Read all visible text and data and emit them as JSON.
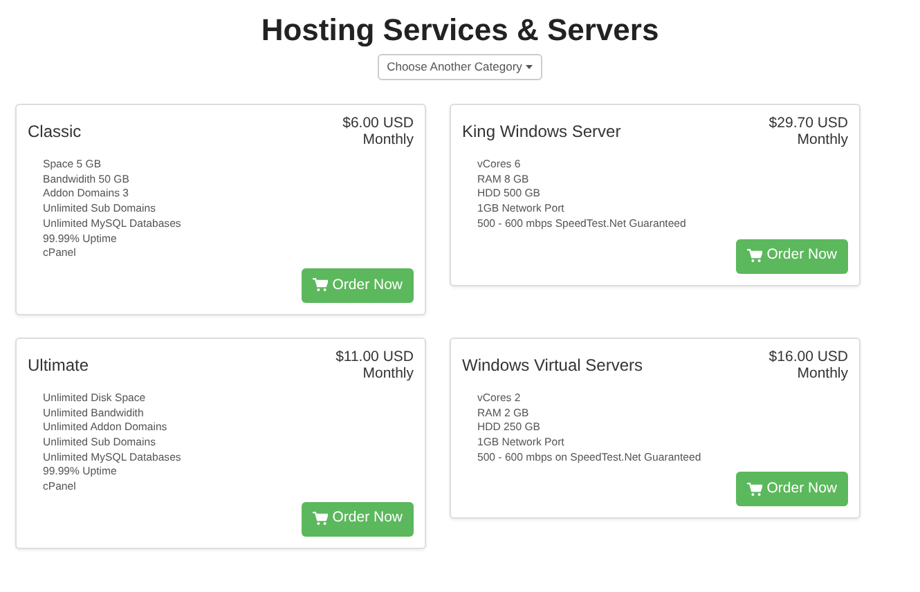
{
  "page": {
    "title": "Hosting Services & Servers",
    "category_button": "Choose Another Category"
  },
  "products": [
    {
      "name": "Classic",
      "price": "$6.00 USD",
      "cycle": "Monthly",
      "features": [
        "Space 5 GB",
        "Bandwidith 50 GB",
        "Addon Domains 3",
        "Unlimited Sub Domains",
        "Unlimited MySQL Databases",
        "99.99% Uptime",
        "cPanel"
      ],
      "button": "Order Now"
    },
    {
      "name": "King Windows Server",
      "price": "$29.70 USD",
      "cycle": "Monthly",
      "features": [
        "vCores 6",
        "RAM 8 GB",
        "HDD 500 GB",
        "1GB Network Port",
        "500 - 600 mbps SpeedTest.Net Guaranteed"
      ],
      "button": "Order Now"
    },
    {
      "name": "Ultimate",
      "price": "$11.00 USD",
      "cycle": "Monthly",
      "features": [
        "Unlimited Disk Space",
        "Unlimited Bandwidith",
        "Unlimited Addon Domains",
        "Unlimited Sub Domains",
        "Unlimited MySQL Databases",
        "99.99% Uptime",
        "cPanel"
      ],
      "button": "Order Now"
    },
    {
      "name": "Windows Virtual Servers",
      "price": "$16.00 USD",
      "cycle": "Monthly",
      "features": [
        "vCores 2",
        "RAM 2 GB",
        "HDD 250 GB",
        "1GB Network Port",
        "500 - 600 mbps on SpeedTest.Net Guaranteed"
      ],
      "button": "Order Now"
    }
  ]
}
